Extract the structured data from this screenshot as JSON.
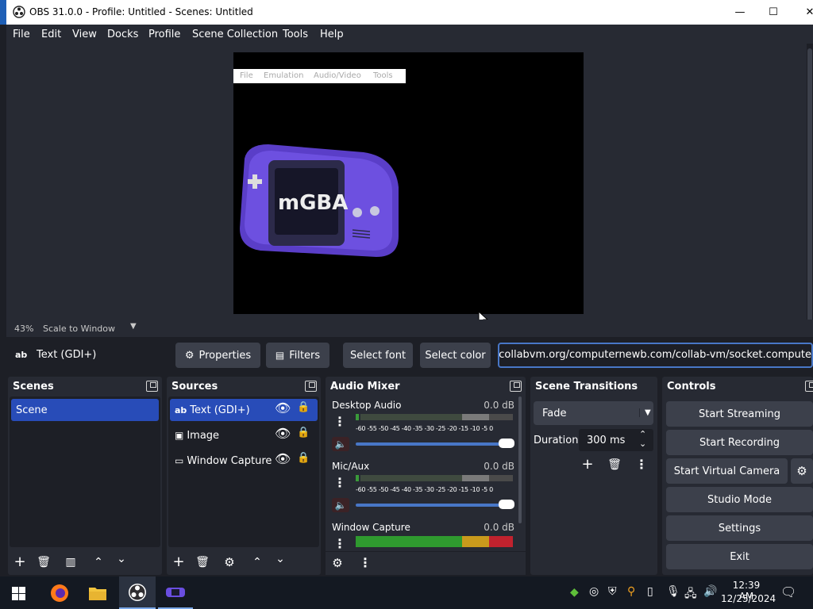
{
  "window": {
    "title": "OBS 31.0.0 - Profile: Untitled - Scenes: Untitled",
    "minimize": "—",
    "maximize": "☐",
    "close": "✕"
  },
  "menu": [
    "File",
    "Edit",
    "View",
    "Docks",
    "Profile",
    "Scene Collection",
    "Tools",
    "Help"
  ],
  "preview": {
    "mgba_menu": [
      "File",
      "Emulation",
      "Audio/Video",
      "Tools"
    ],
    "logo_text": "mGBA"
  },
  "zoom": {
    "percent": "43%",
    "mode": "Scale to Window"
  },
  "source_toolbar": {
    "selected_source": "Text (GDI+)",
    "source_icon": "ab",
    "properties": "Properties",
    "filters": "Filters",
    "select_font": "Select font",
    "select_color": "Select color",
    "text_value": "m/collabvm.org/computernewb.com/collab-vm/socket.compute"
  },
  "scenes": {
    "title": "Scenes",
    "items": [
      "Scene"
    ]
  },
  "sources": {
    "title": "Sources",
    "items": [
      {
        "label": "Text (GDI+)",
        "icon": "ab"
      },
      {
        "label": "Image",
        "icon": "image-icon"
      },
      {
        "label": "Window Capture",
        "icon": "window-icon"
      }
    ]
  },
  "mixer": {
    "title": "Audio Mixer",
    "scale": "-60 -55 -50 -45 -40 -35 -30 -25 -20 -15 -10 -5  0",
    "channels": [
      {
        "name": "Desktop Audio",
        "db": "0.0 dB",
        "muted": true,
        "volume": 1.0
      },
      {
        "name": "Mic/Aux",
        "db": "0.0 dB",
        "muted": true,
        "volume": 1.0
      },
      {
        "name": "Window Capture",
        "db": "0.0 dB",
        "muted": false,
        "volume": 1.0
      }
    ]
  },
  "transitions": {
    "title": "Scene Transitions",
    "type": "Fade",
    "duration_label": "Duration",
    "duration_value": "300 ms"
  },
  "controls": {
    "title": "Controls",
    "start_streaming": "Start Streaming",
    "start_recording": "Start Recording",
    "start_virtual_camera": "Start Virtual Camera",
    "studio_mode": "Studio Mode",
    "settings": "Settings",
    "exit": "Exit"
  },
  "taskbar": {
    "time": "12:39 AM",
    "date": "12/25/2024"
  },
  "colors": {
    "accent": "#4877c7",
    "selection": "#284cb8",
    "panel": "#272a33",
    "background": "#1d1f26",
    "button": "#3c404b"
  }
}
